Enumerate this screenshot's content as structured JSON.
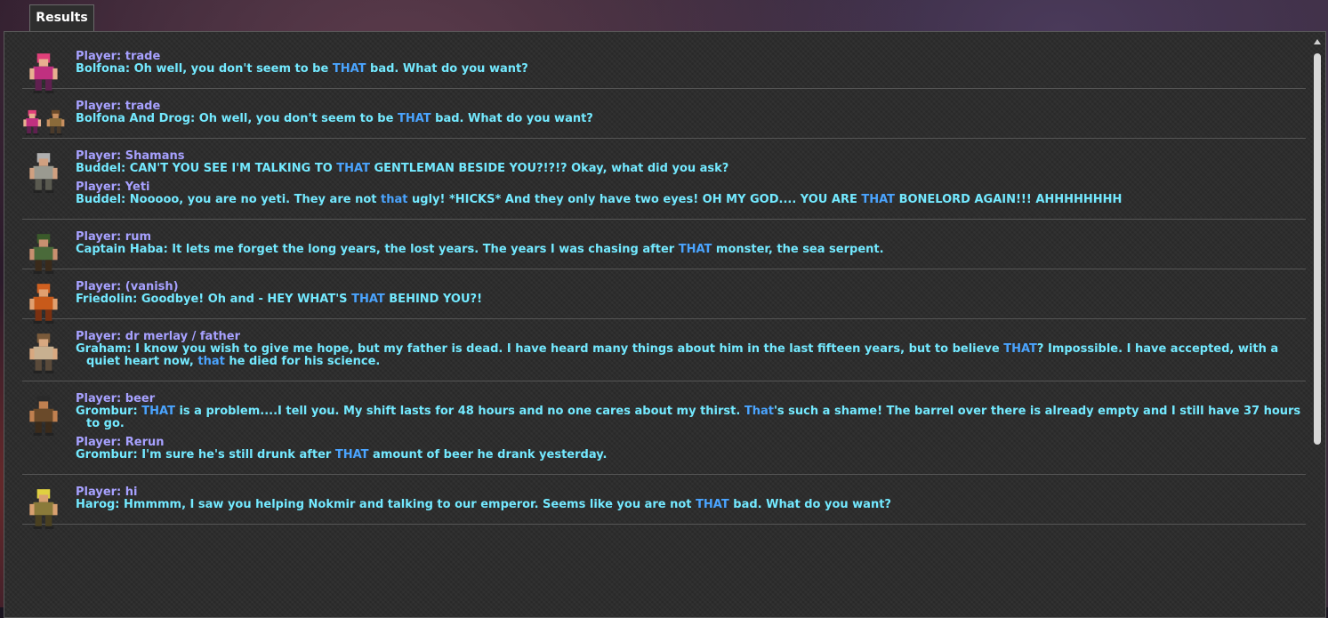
{
  "window": {
    "tab_label": "Results"
  },
  "colors": {
    "keyword": "#a7a1ff",
    "text": "#73e9ff",
    "highlight": "#4aa4ff",
    "panel": "#2b2b2b"
  },
  "entries": [
    {
      "npcs": [
        "bolfona"
      ],
      "dialogues": [
        {
          "keyword": "Player: trade",
          "segments": [
            {
              "t": "Bolfona: Oh well, you don't seem to be "
            },
            {
              "t": "THAT",
              "h": true
            },
            {
              "t": " bad. What do you want?"
            }
          ]
        }
      ]
    },
    {
      "npcs": [
        "bolfona",
        "drog"
      ],
      "dialogues": [
        {
          "keyword": "Player: trade",
          "segments": [
            {
              "t": "Bolfona And Drog: Oh well, you don't seem to be "
            },
            {
              "t": "THAT",
              "h": true
            },
            {
              "t": " bad. What do you want?"
            }
          ]
        }
      ]
    },
    {
      "npcs": [
        "buddel"
      ],
      "dialogues": [
        {
          "keyword": "Player: Shamans",
          "segments": [
            {
              "t": "Buddel: CAN'T YOU SEE I'M TALKING TO "
            },
            {
              "t": "THAT",
              "h": true
            },
            {
              "t": " GENTLEMAN BESIDE YOU?!?!? Okay, what did you ask?"
            }
          ]
        },
        {
          "keyword": "Player: Yeti",
          "segments": [
            {
              "t": "Buddel: Nooooo, you are no yeti. They are not "
            },
            {
              "t": "that",
              "h": true
            },
            {
              "t": " ugly! *HICKS* And they only have two eyes! OH MY GOD.... YOU ARE "
            },
            {
              "t": "THAT",
              "h": true
            },
            {
              "t": " BONELORD AGAIN!!! AHHHHHHHH"
            }
          ]
        }
      ]
    },
    {
      "npcs": [
        "haba"
      ],
      "dialogues": [
        {
          "keyword": "Player: rum",
          "segments": [
            {
              "t": "Captain Haba: It lets me forget the long years, the lost years. The years I was chasing after "
            },
            {
              "t": "THAT",
              "h": true
            },
            {
              "t": " monster, the sea serpent."
            }
          ]
        }
      ]
    },
    {
      "npcs": [
        "friedolin"
      ],
      "dialogues": [
        {
          "keyword": "Player: (vanish)",
          "segments": [
            {
              "t": "Friedolin: Goodbye! Oh and - HEY WHAT'S "
            },
            {
              "t": "THAT",
              "h": true
            },
            {
              "t": " BEHIND YOU?!"
            }
          ]
        }
      ]
    },
    {
      "npcs": [
        "graham"
      ],
      "dialogues": [
        {
          "keyword": "Player: dr merlay / father",
          "segments": [
            {
              "t": "Graham: I know you wish to give me hope, but my father is dead. I have heard many things about him in the last fifteen years, but to believe "
            },
            {
              "t": "THAT",
              "h": true
            },
            {
              "t": "? Impossible. I have accepted, with a quiet heart now, "
            },
            {
              "t": "that",
              "h": true
            },
            {
              "t": " he died for his science."
            }
          ]
        }
      ]
    },
    {
      "npcs": [
        "grombur"
      ],
      "dialogues": [
        {
          "keyword": "Player: beer",
          "segments": [
            {
              "t": "Grombur: "
            },
            {
              "t": "THAT",
              "h": true
            },
            {
              "t": " is a problem....I tell you. My shift lasts for 48 hours and no one cares about my thirst. "
            },
            {
              "t": "That",
              "h": true
            },
            {
              "t": "'s such a shame! The barrel over there is already empty and I still have 37 hours to go."
            }
          ]
        },
        {
          "keyword": "Player: Rerun",
          "segments": [
            {
              "t": "Grombur: I'm sure he's still drunk after "
            },
            {
              "t": "THAT",
              "h": true
            },
            {
              "t": " amount of beer he drank yesterday."
            }
          ]
        }
      ]
    },
    {
      "npcs": [
        "harog"
      ],
      "dialogues": [
        {
          "keyword": "Player: hi",
          "segments": [
            {
              "t": "Harog: Hmmmm, I saw you helping Nokmir and talking to our emperor. Seems like you are not "
            },
            {
              "t": "THAT",
              "h": true
            },
            {
              "t": " bad. What do you want?"
            }
          ]
        }
      ]
    }
  ]
}
